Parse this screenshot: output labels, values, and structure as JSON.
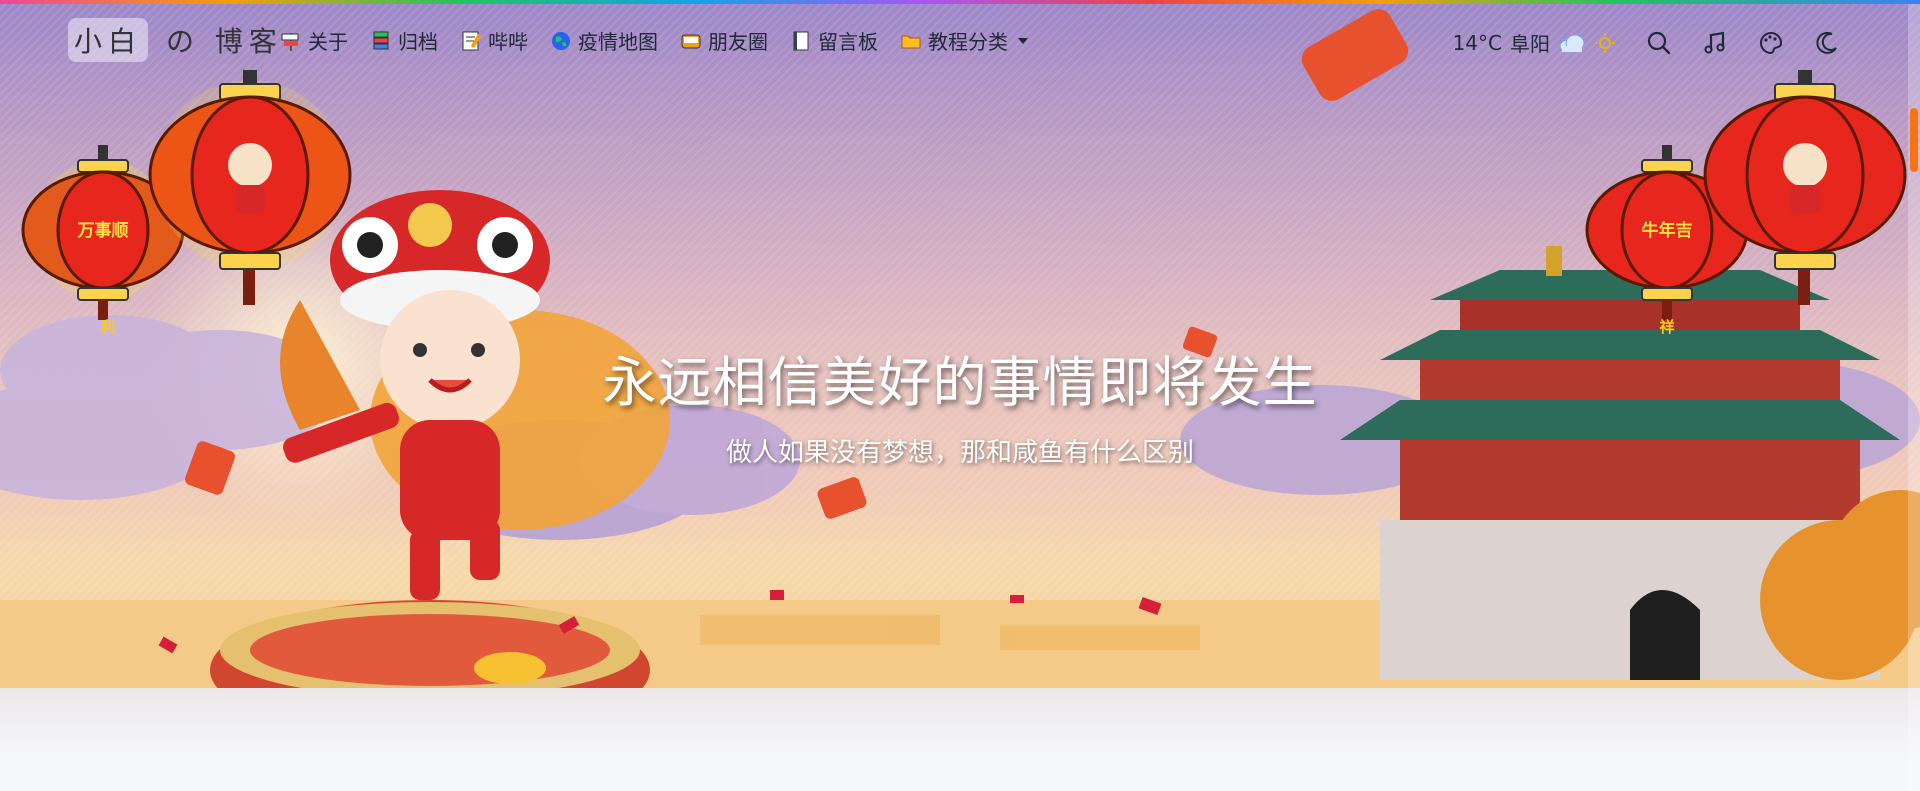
{
  "site": {
    "logo_box": "小白",
    "logo_rest": "の 博客"
  },
  "menu": [
    {
      "label": "关于",
      "icon": "guidepost-icon"
    },
    {
      "label": "归档",
      "icon": "books-icon"
    },
    {
      "label": "哔哔",
      "icon": "memo-icon"
    },
    {
      "label": "疫情地图",
      "icon": "globe-icon"
    },
    {
      "label": "朋友圈",
      "icon": "bento-icon"
    },
    {
      "label": "留言板",
      "icon": "notebook-icon"
    },
    {
      "label": "教程分类",
      "icon": "folder-icon",
      "has_dropdown": true
    }
  ],
  "weather": {
    "temp": "14°C",
    "city": "阜阳",
    "icon": "cloud-icon",
    "aux_icon": "sun-icon"
  },
  "tools": [
    {
      "name": "search",
      "icon": "search-icon"
    },
    {
      "name": "music",
      "icon": "music-note-icon"
    },
    {
      "name": "theme",
      "icon": "palette-icon"
    },
    {
      "name": "dark-mode",
      "icon": "moon-icon"
    }
  ],
  "hero": {
    "title": "永远相信美好的事情即将发生",
    "subtitle": "做人如果没有梦想，那和咸鱼有什么区别"
  },
  "lanterns": {
    "left_small": "万事顺",
    "left_small_tail": "利",
    "right_small": "牛年吉",
    "right_small_tail": "祥"
  },
  "colors": {
    "lantern_red": "#e7261d",
    "lantern_gold": "#fde047",
    "scroll_thumb": "#f97316",
    "hero_top": "#9c86c8",
    "hero_bottom": "#f3cf98"
  }
}
